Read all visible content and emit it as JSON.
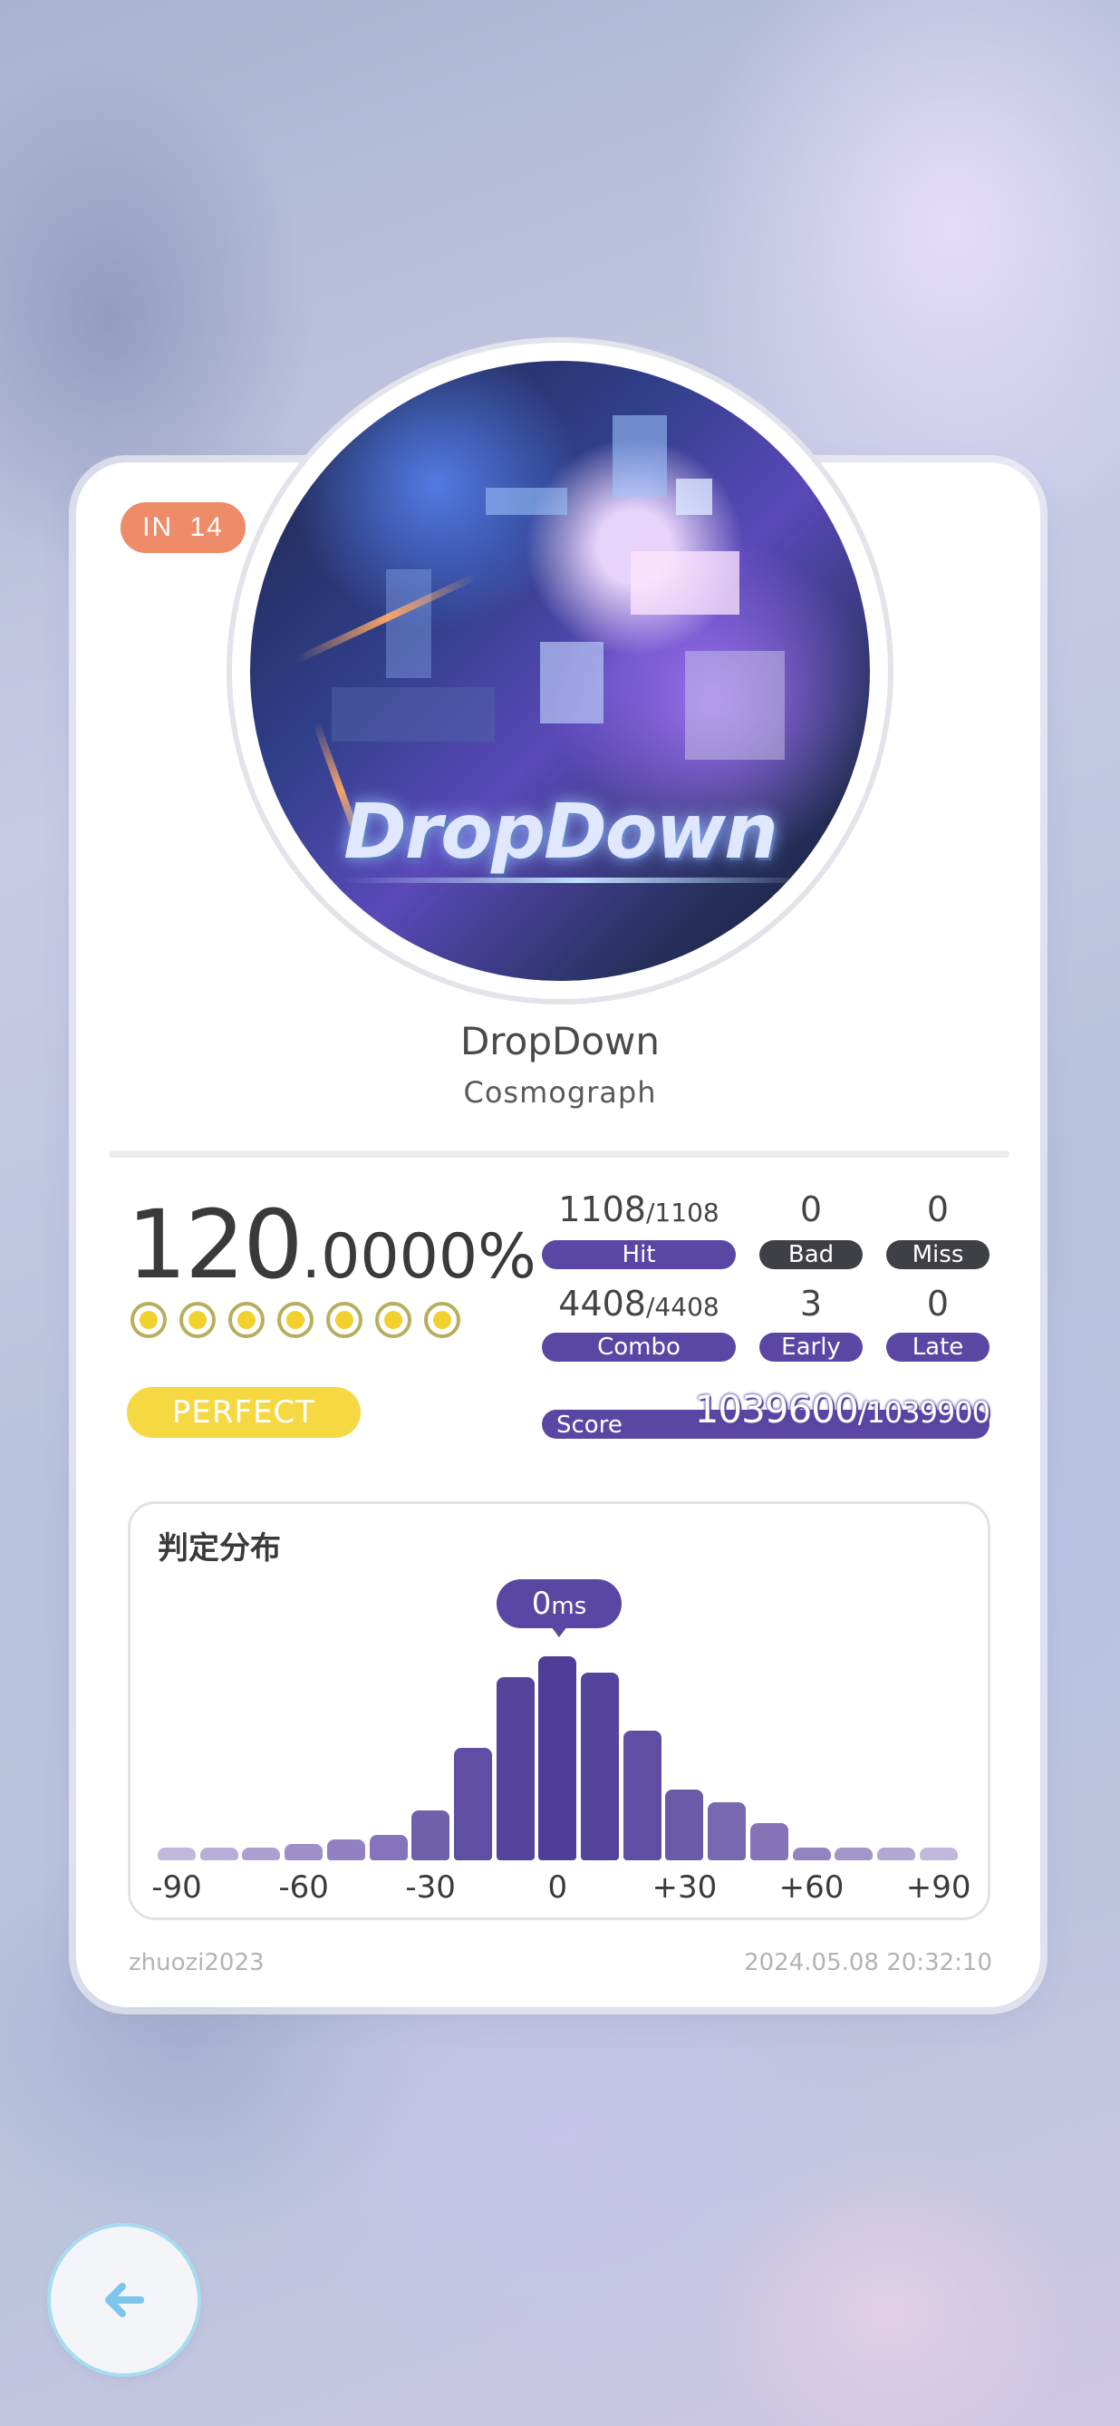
{
  "difficulty": {
    "level": "IN",
    "value": "14"
  },
  "cover": {
    "art_text": "DropDown"
  },
  "song": {
    "title": "DropDown",
    "artist": "Cosmograph"
  },
  "accuracy": {
    "integer": "120",
    "decimal": ".0000%"
  },
  "perfect_dots": 7,
  "rank_label": "PERFECT",
  "stats": {
    "hit": {
      "value": "1108",
      "total": "/1108",
      "label": "Hit"
    },
    "bad": {
      "value": "0",
      "label": "Bad"
    },
    "miss": {
      "value": "0",
      "label": "Miss"
    },
    "combo": {
      "value": "4408",
      "total": "/4408",
      "label": "Combo"
    },
    "early": {
      "value": "3",
      "label": "Early"
    },
    "late": {
      "value": "0",
      "label": "Late"
    }
  },
  "score": {
    "label": "Score",
    "value": "1039600",
    "max": "/1039900"
  },
  "distribution": {
    "title": "判定分布",
    "tooltip_value": "0",
    "tooltip_unit": "ms",
    "x_ticks": [
      "-90",
      "-60",
      "-30",
      "0",
      "+30",
      "+60",
      "+90"
    ]
  },
  "chart_data": {
    "type": "bar",
    "title": "判定分布",
    "categories": [
      "-90",
      "-80",
      "-70",
      "-60",
      "-50",
      "-40",
      "-30",
      "-20",
      "-10",
      "0",
      "+10",
      "+20",
      "+30",
      "+40",
      "+50",
      "+60",
      "+70",
      "+80",
      "+90"
    ],
    "values": [
      3,
      3,
      3,
      4,
      5,
      6,
      12,
      27,
      44,
      49,
      45,
      31,
      17,
      14,
      9,
      3,
      3,
      3,
      3
    ],
    "ylim": [
      0,
      50
    ],
    "colors": [
      "#c2b8dc",
      "#b9aed8",
      "#ad9fd2",
      "#9f8ec9",
      "#9281c2",
      "#8574bb",
      "#7060ac",
      "#5f4ea3",
      "#55449c",
      "#4f3d97",
      "#55449c",
      "#5f4ea3",
      "#6b5aa8",
      "#7868b0",
      "#8474b7",
      "#9483c0",
      "#a395ca",
      "#b3a7d3",
      "#c2b8dc"
    ]
  },
  "footer": {
    "username": "zhuozi2023",
    "timestamp": "2024.05.08 20:32:10"
  },
  "back_button": {
    "icon": "arrow-left-icon"
  }
}
